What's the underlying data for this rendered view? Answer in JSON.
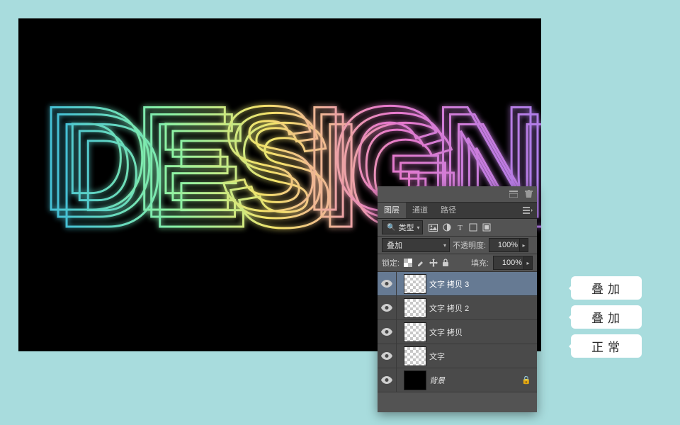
{
  "canvas_text": "DESIGN",
  "panel": {
    "tabs": {
      "layers": "图层",
      "channels": "通道",
      "paths": "路径"
    },
    "filter_label": "类型",
    "blend_mode": "叠加",
    "opacity_label": "不透明度",
    "opacity_value": "100%",
    "lock_label": "锁定:",
    "fill_label": "填充",
    "fill_value": "100%"
  },
  "layers": [
    {
      "name": "文字 拷贝 3",
      "selected": true,
      "thumb": "checker",
      "bg": false
    },
    {
      "name": "文字 拷贝 2",
      "selected": false,
      "thumb": "checker",
      "bg": false
    },
    {
      "name": "文字 拷贝",
      "selected": false,
      "thumb": "checker",
      "bg": false
    },
    {
      "name": "文字",
      "selected": false,
      "thumb": "checker",
      "bg": false
    },
    {
      "name": "背景",
      "selected": false,
      "thumb": "black",
      "bg": true
    }
  ],
  "callouts": [
    "叠加",
    "叠加",
    "正常"
  ],
  "colors": {
    "neon": [
      "#3fbcd9",
      "#8af2a5",
      "#f4e26a",
      "#e77acb",
      "#b07de8"
    ]
  }
}
